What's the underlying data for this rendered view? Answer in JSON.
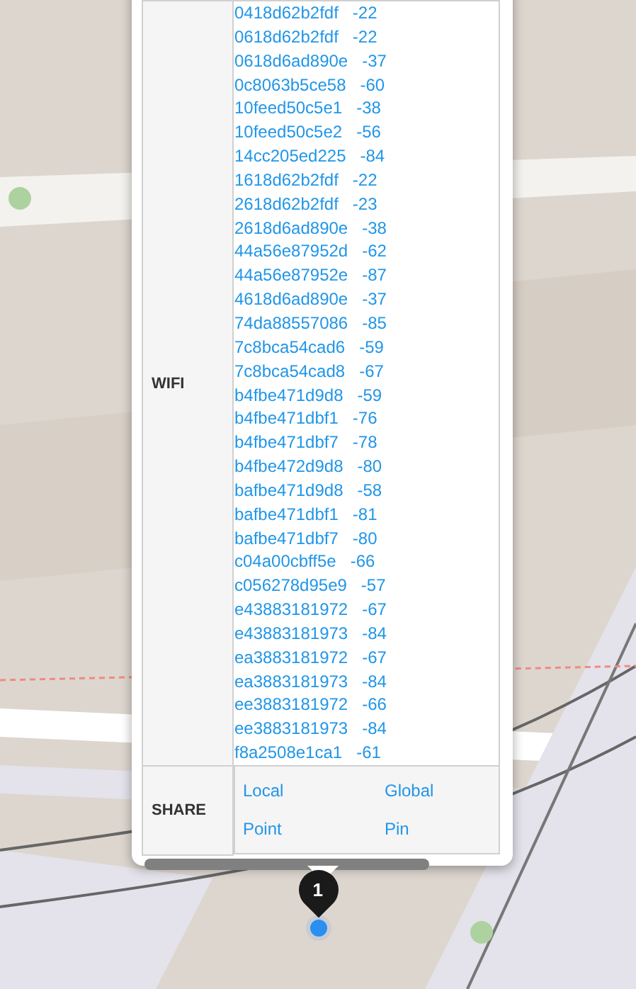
{
  "popup": {
    "rows": [
      {
        "kind": "list",
        "label": "WIFI",
        "entries": [
          "0418d62b2fdf   -22",
          "0618d62b2fdf   -22",
          "0618d6ad890e   -37",
          "0c8063b5ce58   -60",
          "10feed50c5e1   -38",
          "10feed50c5e2   -56",
          "14cc205ed225   -84",
          "1618d62b2fdf   -22",
          "2618d62b2fdf   -23",
          "2618d6ad890e   -38",
          "44a56e87952d   -62",
          "44a56e87952e   -87",
          "4618d6ad890e   -37",
          "74da88557086   -85",
          "7c8bca54cad6   -59",
          "7c8bca54cad8   -67",
          "b4fbe471d9d8   -59",
          "b4fbe471dbf1   -76",
          "b4fbe471dbf7   -78",
          "b4fbe472d9d8   -80",
          "bafbe471d9d8   -58",
          "bafbe471dbf1   -81",
          "bafbe471dbf7   -80",
          "c04a00cbff5e   -66",
          "c056278d95e9   -57",
          "e43883181972   -67",
          "e43883181973   -84",
          "ea3883181972   -67",
          "ea3883181973   -84",
          "ee3883181972   -66",
          "ee3883181973   -84",
          "f8a2508e1ca1   -61"
        ]
      },
      {
        "kind": "links",
        "label": "SHARE",
        "links": [
          "Local Point",
          "Global Pin"
        ]
      }
    ]
  },
  "marker": {
    "label": "1"
  }
}
